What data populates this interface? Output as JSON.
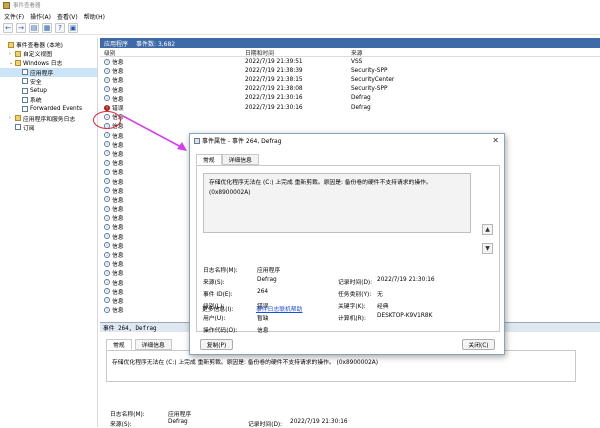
{
  "window": {
    "title": "事件查看器"
  },
  "menu": [
    "文件(F)",
    "操作(A)",
    "查看(V)",
    "帮助(H)"
  ],
  "toolbar": [
    "←",
    "→",
    "▤",
    "▦",
    "?",
    "▣"
  ],
  "tree": [
    {
      "label": "事件查看器 (本地)",
      "indent": 0,
      "toggle": "",
      "icon": "folder",
      "selected": false,
      "icon_name": "event-viewer-icon"
    },
    {
      "label": "自定义视图",
      "indent": 1,
      "toggle": "›",
      "icon": "folder",
      "selected": false,
      "icon_name": "folder-icon"
    },
    {
      "label": "Windows 日志",
      "indent": 1,
      "toggle": "⌄",
      "icon": "folder",
      "selected": false,
      "icon_name": "folder-icon"
    },
    {
      "label": "应用程序",
      "indent": 2,
      "toggle": "",
      "icon": "log",
      "selected": true,
      "icon_name": "log-icon"
    },
    {
      "label": "安全",
      "indent": 2,
      "toggle": "",
      "icon": "log",
      "selected": false,
      "icon_name": "log-icon"
    },
    {
      "label": "Setup",
      "indent": 2,
      "toggle": "",
      "icon": "log",
      "selected": false,
      "icon_name": "log-icon"
    },
    {
      "label": "系统",
      "indent": 2,
      "toggle": "",
      "icon": "log",
      "selected": false,
      "icon_name": "log-icon"
    },
    {
      "label": "Forwarded Events",
      "indent": 2,
      "toggle": "",
      "icon": "log",
      "selected": false,
      "icon_name": "log-icon"
    },
    {
      "label": "应用程序和服务日志",
      "indent": 1,
      "toggle": "›",
      "icon": "folder",
      "selected": false,
      "icon_name": "folder-icon"
    },
    {
      "label": "订阅",
      "indent": 1,
      "toggle": "",
      "icon": "log",
      "selected": false,
      "icon_name": "subscription-icon"
    }
  ],
  "list": {
    "header_title": "应用程序",
    "header_count": "事件数: 3,682",
    "columns": [
      "级别",
      "日期和时间",
      "来源"
    ],
    "rows": [
      {
        "level": "信息",
        "date": "2022/7/19 21:39:51",
        "source": "VSS",
        "error": false
      },
      {
        "level": "信息",
        "date": "2022/7/19 21:38:39",
        "source": "Security-SPP",
        "error": false
      },
      {
        "level": "信息",
        "date": "2022/7/19 21:38:15",
        "source": "SecurityCenter",
        "error": false
      },
      {
        "level": "信息",
        "date": "2022/7/19 21:38:08",
        "source": "Security-SPP",
        "error": false
      },
      {
        "level": "信息",
        "date": "2022/7/19 21:30:16",
        "source": "Defrag",
        "error": false
      },
      {
        "level": "错误",
        "date": "2022/7/19 21:30:16",
        "source": "Defrag",
        "error": true
      },
      {
        "level": "信息",
        "date": "",
        "source": "",
        "error": false
      },
      {
        "level": "信息",
        "date": "",
        "source": "",
        "error": false
      },
      {
        "level": "信息",
        "date": "",
        "source": "",
        "error": false
      },
      {
        "level": "信息",
        "date": "",
        "source": "",
        "error": false
      },
      {
        "level": "信息",
        "date": "",
        "source": "",
        "error": false
      },
      {
        "level": "信息",
        "date": "",
        "source": "",
        "error": false
      },
      {
        "level": "信息",
        "date": "",
        "source": "",
        "error": false
      },
      {
        "level": "信息",
        "date": "",
        "source": "",
        "error": false
      },
      {
        "level": "信息",
        "date": "",
        "source": "",
        "error": false
      },
      {
        "level": "信息",
        "date": "",
        "source": "",
        "error": false
      },
      {
        "level": "信息",
        "date": "",
        "source": "",
        "error": false
      },
      {
        "level": "信息",
        "date": "",
        "source": "",
        "error": false
      },
      {
        "level": "信息",
        "date": "",
        "source": "",
        "error": false
      },
      {
        "level": "信息",
        "date": "",
        "source": "",
        "error": false
      },
      {
        "level": "信息",
        "date": "",
        "source": "",
        "error": false
      },
      {
        "level": "信息",
        "date": "",
        "source": "",
        "error": false
      },
      {
        "level": "信息",
        "date": "",
        "source": "",
        "error": false
      },
      {
        "level": "信息",
        "date": "",
        "source": "",
        "error": false
      },
      {
        "level": "信息",
        "date": "",
        "source": "",
        "error": false
      },
      {
        "level": "信息",
        "date": "",
        "source": "",
        "error": false
      },
      {
        "level": "信息",
        "date": "",
        "source": "",
        "error": false
      },
      {
        "level": "信息",
        "date": "",
        "source": "",
        "error": false
      }
    ]
  },
  "bottom": {
    "header": "事件 264, Defrag",
    "tabs": [
      "常规",
      "详细信息"
    ],
    "description": "存储优化程序无法在 (C:) 上完成 重新剪裁。原因是: 备份卷的硬件不支持请求的操作。 (0x8900002A)",
    "log_name_label": "日志名称(M):",
    "log_name_value": "应用程序",
    "source_label": "来源(S):",
    "source_value": "Defrag",
    "logged_label": "记录时间(D):",
    "logged_value": "2022/7/19 21:30:16"
  },
  "dialog": {
    "title": "事件属性 - 事件 264, Defrag",
    "close": "✕",
    "tabs": [
      "常规",
      "详细信息"
    ],
    "description_line1": "存储优化程序无法在 (C:) 上完成 重新剪裁。原因是: 备份卷的硬件不支持请求的操作。",
    "description_line2": "(0x8900002A)",
    "fields": {
      "log_name_label": "日志名称(M):",
      "log_name_value": "应用程序",
      "source_label": "来源(S):",
      "source_value": "Defrag",
      "logged_label": "记录时间(D):",
      "logged_value": "2022/7/19 21:30:16",
      "event_id_label": "事件 ID(E):",
      "event_id_value": "264",
      "task_label": "任务类别(Y):",
      "task_value": "无",
      "level_label": "级别(L):",
      "level_value": "错误",
      "keywords_label": "关键字(K):",
      "keywords_value": "经典",
      "user_label": "用户(U):",
      "user_value": "暂缺",
      "computer_label": "计算机(R):",
      "computer_value": "DESKTOP-K9V1R8K",
      "opcode_label": "操作代码(O):",
      "opcode_value": "信息",
      "more_label": "更多信息(I):",
      "more_link": "事件日志联机帮助"
    },
    "copy_button": "复制(P)",
    "close_button": "关闭(C)"
  }
}
